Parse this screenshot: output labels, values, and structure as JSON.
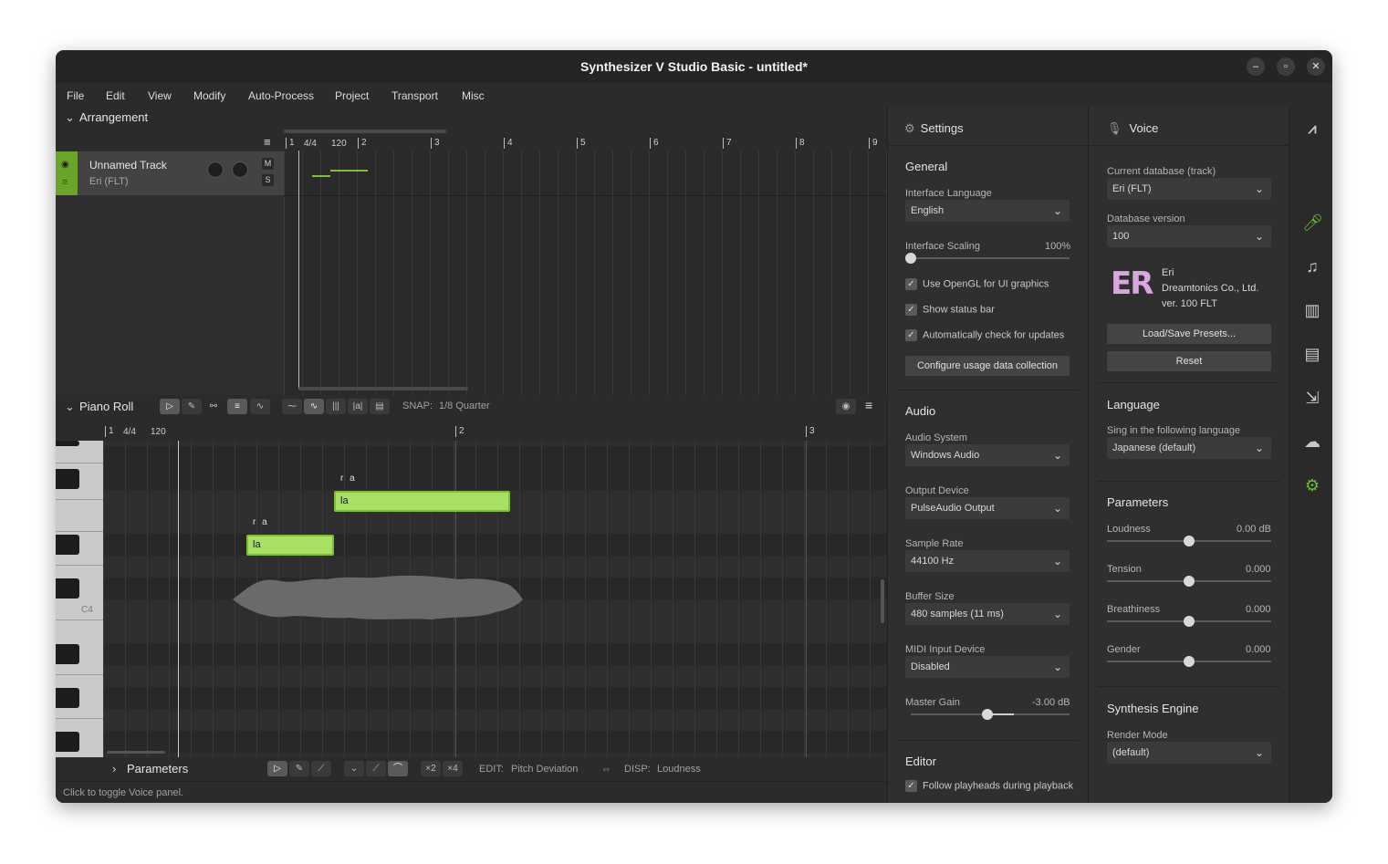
{
  "window": {
    "title": "Synthesizer V Studio Basic - untitled*",
    "minimize": "–",
    "maximize": "▫",
    "close": "✕"
  },
  "menu": [
    "File",
    "Edit",
    "View",
    "Modify",
    "Auto-Process",
    "Project",
    "Transport",
    "Misc"
  ],
  "arrangement": {
    "title": "Arrangement",
    "ruler": {
      "start": "1",
      "timesig": "4/4",
      "tempo": "120",
      "bars": [
        "2",
        "3",
        "4",
        "5",
        "6",
        "7",
        "8",
        "9"
      ]
    },
    "track": {
      "name": "Unnamed Track",
      "voice": "Eri (FLT)",
      "mute": "M",
      "solo": "S"
    }
  },
  "piano_roll": {
    "title": "Piano Roll",
    "snap_label": "SNAP:",
    "snap_value": "1/8 Quarter",
    "ruler": {
      "start": "1",
      "timesig": "4/4",
      "tempo": "120",
      "bar2": "2",
      "bar3": "3"
    },
    "key_label": "C4",
    "notes": [
      {
        "lyric": "la",
        "phoneme": "r a"
      },
      {
        "lyric": "la",
        "phoneme": "r a"
      }
    ],
    "params": {
      "title": "Parameters",
      "x2": "×2",
      "x4": "×4",
      "edit_label": "EDIT:",
      "edit_value": "Pitch Deviation",
      "disp_label": "DISP:",
      "disp_value": "Loudness",
      "close": "✕"
    }
  },
  "status": "Click to toggle Voice panel.",
  "settings": {
    "title": "Settings",
    "general": "General",
    "interface_language_label": "Interface Language",
    "interface_language": "English",
    "interface_scaling_label": "Interface Scaling",
    "interface_scaling_value": "100%",
    "interface_scaling_fraction": 0.0,
    "opengl": "Use OpenGL for UI graphics",
    "status_bar": "Show status bar",
    "auto_update": "Automatically check for updates",
    "configure_button": "Configure usage data collection",
    "audio": "Audio",
    "audio_system_label": "Audio System",
    "audio_system": "Windows Audio",
    "output_device_label": "Output Device",
    "output_device": "PulseAudio Output",
    "sample_rate_label": "Sample Rate",
    "sample_rate": "44100 Hz",
    "buffer_size_label": "Buffer Size",
    "buffer_size": "480 samples (11 ms)",
    "midi_label": "MIDI Input Device",
    "midi": "Disabled",
    "master_gain_label": "Master Gain",
    "master_gain_value": "-3.00 dB",
    "editor": "Editor",
    "follow_playheads": "Follow playheads during playback"
  },
  "voice": {
    "title": "Voice",
    "db_label": "Current database (track)",
    "db_value": "Eri (FLT)",
    "version_label": "Database version",
    "version_value": "100",
    "avatar_text": "ER",
    "singer_name": "Eri",
    "singer_company": "Dreamtonics Co., Ltd.",
    "singer_version": "ver. 100 FLT",
    "presets_button": "Load/Save Presets...",
    "reset_button": "Reset",
    "language_title": "Language",
    "language_label": "Sing in the following language",
    "language_value": "Japanese (default)",
    "params_title": "Parameters",
    "loudness_label": "Loudness",
    "loudness_value": "0.00 dB",
    "tension_label": "Tension",
    "tension_value": "0.000",
    "breathiness_label": "Breathiness",
    "breathiness_value": "0.000",
    "gender_label": "Gender",
    "gender_value": "0.000",
    "engine_title": "Synthesis Engine",
    "render_mode_label": "Render Mode",
    "render_mode_value": "(default)"
  },
  "colors": {
    "accent": "#6aa52a",
    "note_fill": "#a8e063",
    "background": "#2b2b2b"
  }
}
